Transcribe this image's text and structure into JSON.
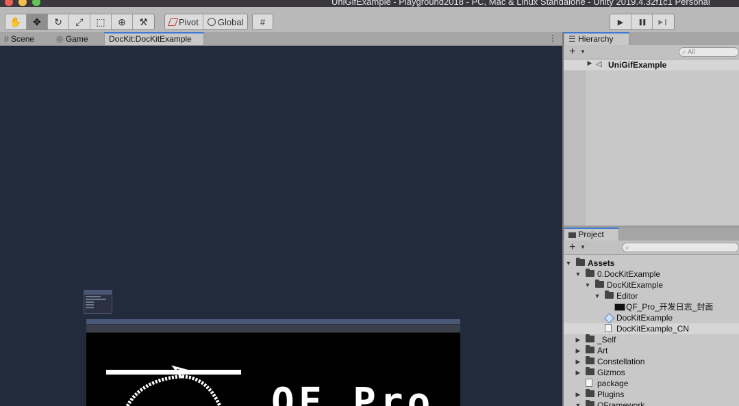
{
  "window": {
    "title": "UniGifExample - Playground2018 - PC, Mac & Linux Standalone - Unity 2019.4.32f1c1 Personal"
  },
  "toolbar": {
    "tools": [
      {
        "name": "hand-tool",
        "glyph": "✋"
      },
      {
        "name": "move-tool",
        "glyph": "✥"
      },
      {
        "name": "rotate-tool",
        "glyph": "↻"
      },
      {
        "name": "scale-tool",
        "glyph": "⤢"
      },
      {
        "name": "rect-tool",
        "glyph": "⬚"
      },
      {
        "name": "transform-tool",
        "glyph": "⊕"
      },
      {
        "name": "custom-tool",
        "glyph": "⚒"
      }
    ],
    "pivot_label": "Pivot",
    "global_label": "Global",
    "play_glyph": "▶",
    "pause_glyph": "❚❚",
    "step_glyph": "▶❙"
  },
  "scene_tabs": {
    "scene": "Scene",
    "game": "Game",
    "dockkit": "DocKit:DocKitExample",
    "menu_glyph": "⋮"
  },
  "hierarchy": {
    "tab": "Hierarchy",
    "search_placeholder": "All",
    "root_item": "UniGifExample"
  },
  "project": {
    "tab": "Project",
    "tree": [
      {
        "label": "Assets",
        "depth": 0,
        "expanded": true,
        "icon": "folder"
      },
      {
        "label": "0.DocKitExample",
        "depth": 1,
        "expanded": true,
        "icon": "folder"
      },
      {
        "label": "DocKitExample",
        "depth": 2,
        "expanded": true,
        "icon": "folder"
      },
      {
        "label": "Editor",
        "depth": 3,
        "expanded": true,
        "icon": "folder"
      },
      {
        "label": "QF_Pro_开发日志_封面",
        "depth": 4,
        "icon": "image"
      },
      {
        "label": "DocKitExample",
        "depth": 3,
        "icon": "script"
      },
      {
        "label": "DocKitExample_CN",
        "depth": 3,
        "icon": "file",
        "selected": true
      },
      {
        "label": "_Self",
        "depth": 1,
        "expanded": false,
        "icon": "folder"
      },
      {
        "label": "Art",
        "depth": 1,
        "expanded": false,
        "icon": "folder"
      },
      {
        "label": "Constellation",
        "depth": 1,
        "expanded": false,
        "icon": "folder"
      },
      {
        "label": "Gizmos",
        "depth": 1,
        "expanded": false,
        "icon": "folder"
      },
      {
        "label": "package",
        "depth": 1,
        "icon": "file"
      },
      {
        "label": "Plugins",
        "depth": 1,
        "expanded": false,
        "icon": "folder"
      },
      {
        "label": "QFramework",
        "depth": 1,
        "expanded": true,
        "icon": "folder"
      }
    ]
  },
  "preview": {
    "banner_text": "QF Pro"
  },
  "colors": {
    "dock_background": "#222b3b",
    "accent": "#3c7bd3",
    "light_close": "#ec5f57",
    "light_min": "#f4bf4f",
    "light_max": "#61c554"
  }
}
